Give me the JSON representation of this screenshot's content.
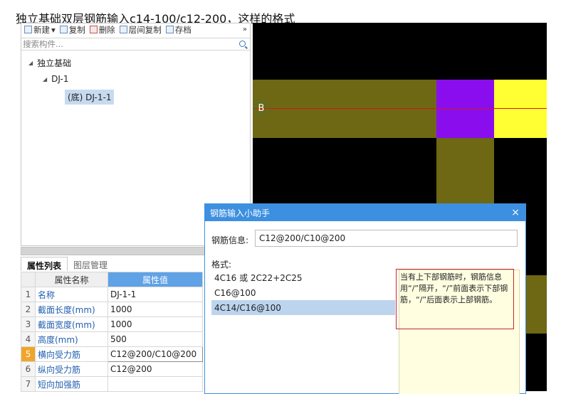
{
  "question": "独立基础双层钢筋输入c14-100/c12-200，这样的格式",
  "toolbar": {
    "new_label": "新建",
    "new_dropdown": "▾",
    "copy_label": "复制",
    "delete_label": "删除",
    "floor_copy_label": "层间复制",
    "archive_label": "存档",
    "more_label": "»"
  },
  "search": {
    "placeholder": "搜索构件..."
  },
  "tree": {
    "root": "独立基础",
    "child": "DJ-1",
    "leaf": "(底) DJ-1-1"
  },
  "props": {
    "tabs": [
      "属性列表",
      "图层管理"
    ],
    "col_name": "属性名称",
    "col_value": "属性值",
    "rows": [
      {
        "idx": "1",
        "name": "名称",
        "value": "DJ-1-1"
      },
      {
        "idx": "2",
        "name": "截面长度(mm)",
        "value": "1000"
      },
      {
        "idx": "3",
        "name": "截面宽度(mm)",
        "value": "1000"
      },
      {
        "idx": "4",
        "name": "高度(mm)",
        "value": "500"
      },
      {
        "idx": "5",
        "name": "横向受力筋",
        "value": "C12@200/C10@200"
      },
      {
        "idx": "6",
        "name": "纵向受力筋",
        "value": "C12@200"
      },
      {
        "idx": "7",
        "name": "短向加强筋",
        "value": ""
      }
    ]
  },
  "canvas": {
    "axis_label": "B",
    "colors": {
      "background": "#000000",
      "olive": "#6e6714",
      "purple": "#8a0eed",
      "yellow": "#ffff33",
      "axis_line": "#d11a1a"
    }
  },
  "dialog": {
    "title": "钢筋输入小助手",
    "close": "×",
    "info_label": "钢筋信息:",
    "info_value": "C12@200/C10@200",
    "format_label": "格式:",
    "formats": [
      "4C16 或 2C22+2C25",
      "C16@100",
      "4C14/C16@100"
    ],
    "help": "当有上下部钢筋时，钢筋信息用“/”隔开，“/”前面表示下部钢筋，“/”后面表示上部钢筋。"
  }
}
